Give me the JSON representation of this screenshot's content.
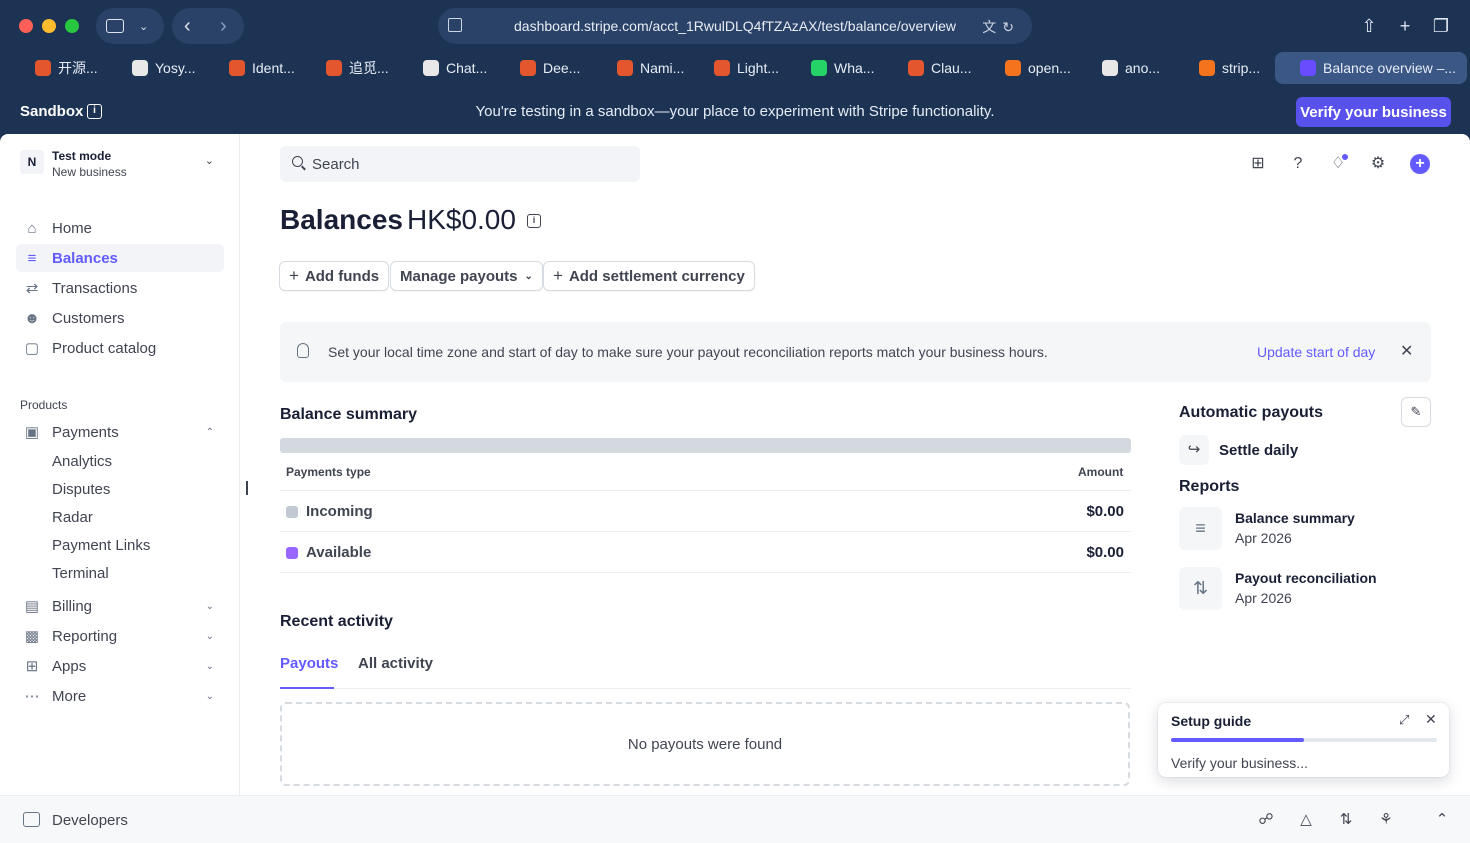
{
  "browser": {
    "url": "dashboard.stripe.com/acct_1RwulDLQ4fTZAzAX/test/balance/overview",
    "tabs": [
      {
        "label": "开源...",
        "color": "#e4572e"
      },
      {
        "label": "Yosy...",
        "color": "#e8e8e8"
      },
      {
        "label": "Ident...",
        "color": "#e4572e"
      },
      {
        "label": "追觅...",
        "color": "#e4572e"
      },
      {
        "label": "Chat...",
        "color": "#e8e8e8"
      },
      {
        "label": "Dee...",
        "color": "#e4572e"
      },
      {
        "label": "Nami...",
        "color": "#e4572e"
      },
      {
        "label": "Light...",
        "color": "#e4572e"
      },
      {
        "label": "Wha...",
        "color": "#25d366"
      },
      {
        "label": "Clau...",
        "color": "#e4572e"
      },
      {
        "label": "open...",
        "color": "#f4731c"
      },
      {
        "label": "ano...",
        "color": "#e8e8e8"
      },
      {
        "label": "strip...",
        "color": "#f4731c"
      }
    ],
    "active_tab": "Balance overview –..."
  },
  "sandbox": {
    "label": "Sandbox",
    "message": "You're testing in a sandbox—your place to experiment with Stripe functionality.",
    "verify_button": "Verify your business"
  },
  "account": {
    "avatar": "N",
    "mode": "Test mode",
    "name": "New business"
  },
  "sidebar": {
    "items": [
      "Home",
      "Balances",
      "Transactions",
      "Customers",
      "Product catalog"
    ],
    "products_title": "Products",
    "payments": "Payments",
    "payments_sub": [
      "Analytics",
      "Disputes",
      "Radar",
      "Payment Links",
      "Terminal"
    ],
    "groups": [
      "Billing",
      "Reporting",
      "Apps",
      "More"
    ],
    "developers": "Developers"
  },
  "search": {
    "placeholder": "Search"
  },
  "page": {
    "title": "Balances",
    "amount": "HK$0.00",
    "buttons": {
      "add_funds": "Add funds",
      "manage_payouts": "Manage payouts",
      "add_settlement": "Add settlement currency"
    }
  },
  "banner": {
    "text": "Set your local time zone and start of day to make sure your payout reconciliation reports match your business hours.",
    "link": "Update start of day"
  },
  "summary": {
    "title": "Balance summary",
    "col_type": "Payments type",
    "col_amount": "Amount",
    "rows": [
      {
        "label": "Incoming",
        "amount": "$0.00",
        "color": "#c3c9d3"
      },
      {
        "label": "Available",
        "amount": "$0.00",
        "color": "#9966ff"
      }
    ]
  },
  "activity": {
    "title": "Recent activity",
    "tabs": [
      "Payouts",
      "All activity"
    ],
    "empty": "No payouts were found"
  },
  "payouts": {
    "title": "Automatic payouts",
    "schedule": "Settle daily"
  },
  "reports": {
    "title": "Reports",
    "items": [
      {
        "title": "Balance summary",
        "date": "Apr 2026"
      },
      {
        "title": "Payout reconciliation",
        "date": "Apr 2026"
      }
    ]
  },
  "setup_guide": {
    "title": "Setup guide",
    "subtitle": "Verify your business...",
    "progress": 0.5
  },
  "colors": {
    "accent": "#635bff",
    "chrome": "#1c3353"
  }
}
